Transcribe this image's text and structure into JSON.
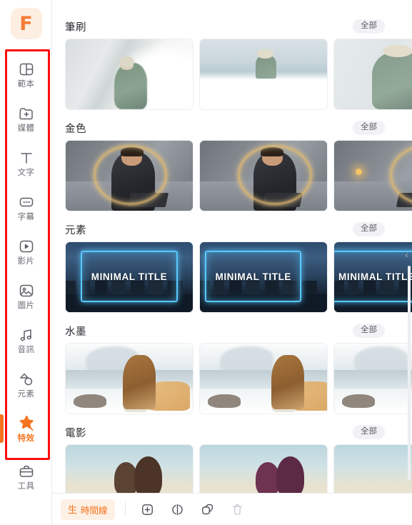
{
  "app": {
    "logo_text": "F",
    "accent_color": "#f5741f",
    "highlight_box_color": "#fb0d0d"
  },
  "sidebar": {
    "items": [
      {
        "label": "範本",
        "icon": "template-icon",
        "active": false
      },
      {
        "label": "媒體",
        "icon": "media-folder-add-icon",
        "active": false
      },
      {
        "label": "文字",
        "icon": "text-t-icon",
        "active": false
      },
      {
        "label": "字幕",
        "icon": "subtitle-icon",
        "active": false
      },
      {
        "label": "影片",
        "icon": "video-play-icon",
        "active": false
      },
      {
        "label": "圖片",
        "icon": "image-icon",
        "active": false
      },
      {
        "label": "音訊",
        "icon": "music-note-icon",
        "active": false
      },
      {
        "label": "元素",
        "icon": "shapes-icon",
        "active": false
      },
      {
        "label": "特效",
        "icon": "star-effect-icon",
        "active": true
      }
    ],
    "tools": {
      "label": "工具",
      "icon": "toolbox-icon"
    }
  },
  "main": {
    "all_label": "全部",
    "collapse_icon": "chevron-left-icon",
    "sections": [
      {
        "title": "筆刷",
        "cards": [
          {
            "art": "art-brush1",
            "caption": ""
          },
          {
            "art": "art-brush2",
            "caption": ""
          },
          {
            "art": "art-brush3",
            "caption": ""
          }
        ]
      },
      {
        "title": "金色",
        "cards": [
          {
            "art": "art-gold",
            "caption": ""
          },
          {
            "art": "art-gold art-gold2",
            "caption": ""
          },
          {
            "art": "art-gold art-gold3",
            "caption": ""
          }
        ]
      },
      {
        "title": "元素",
        "cards": [
          {
            "art": "art-elem",
            "caption": "MINIMAL TITLE"
          },
          {
            "art": "art-elem art-elem2",
            "caption": "MINIMAL TITLE"
          },
          {
            "art": "art-elem art-elem3",
            "caption": "MINIMAL TITLE"
          }
        ]
      },
      {
        "title": "水墨",
        "cards": [
          {
            "art": "art-ink",
            "caption": ""
          },
          {
            "art": "art-ink art-ink2",
            "caption": ""
          },
          {
            "art": "art-ink art-ink3",
            "caption": ""
          }
        ]
      },
      {
        "title": "電影",
        "cards": [
          {
            "art": "art-film",
            "caption": ""
          },
          {
            "art": "art-film art-film2",
            "caption": ""
          },
          {
            "art": "art-film art-film3",
            "caption": ""
          }
        ]
      }
    ]
  },
  "bottombar": {
    "timeline_label": "時間線",
    "timeline_icon": "timeline-icon",
    "buttons": [
      {
        "icon": "add-icon",
        "name": "add-clip-button",
        "disabled": false
      },
      {
        "icon": "split-icon",
        "name": "split-clip-button",
        "disabled": false
      },
      {
        "icon": "duplicate-icon",
        "name": "duplicate-clip-button",
        "disabled": false
      },
      {
        "icon": "trash-icon",
        "name": "delete-clip-button",
        "disabled": true
      }
    ]
  }
}
